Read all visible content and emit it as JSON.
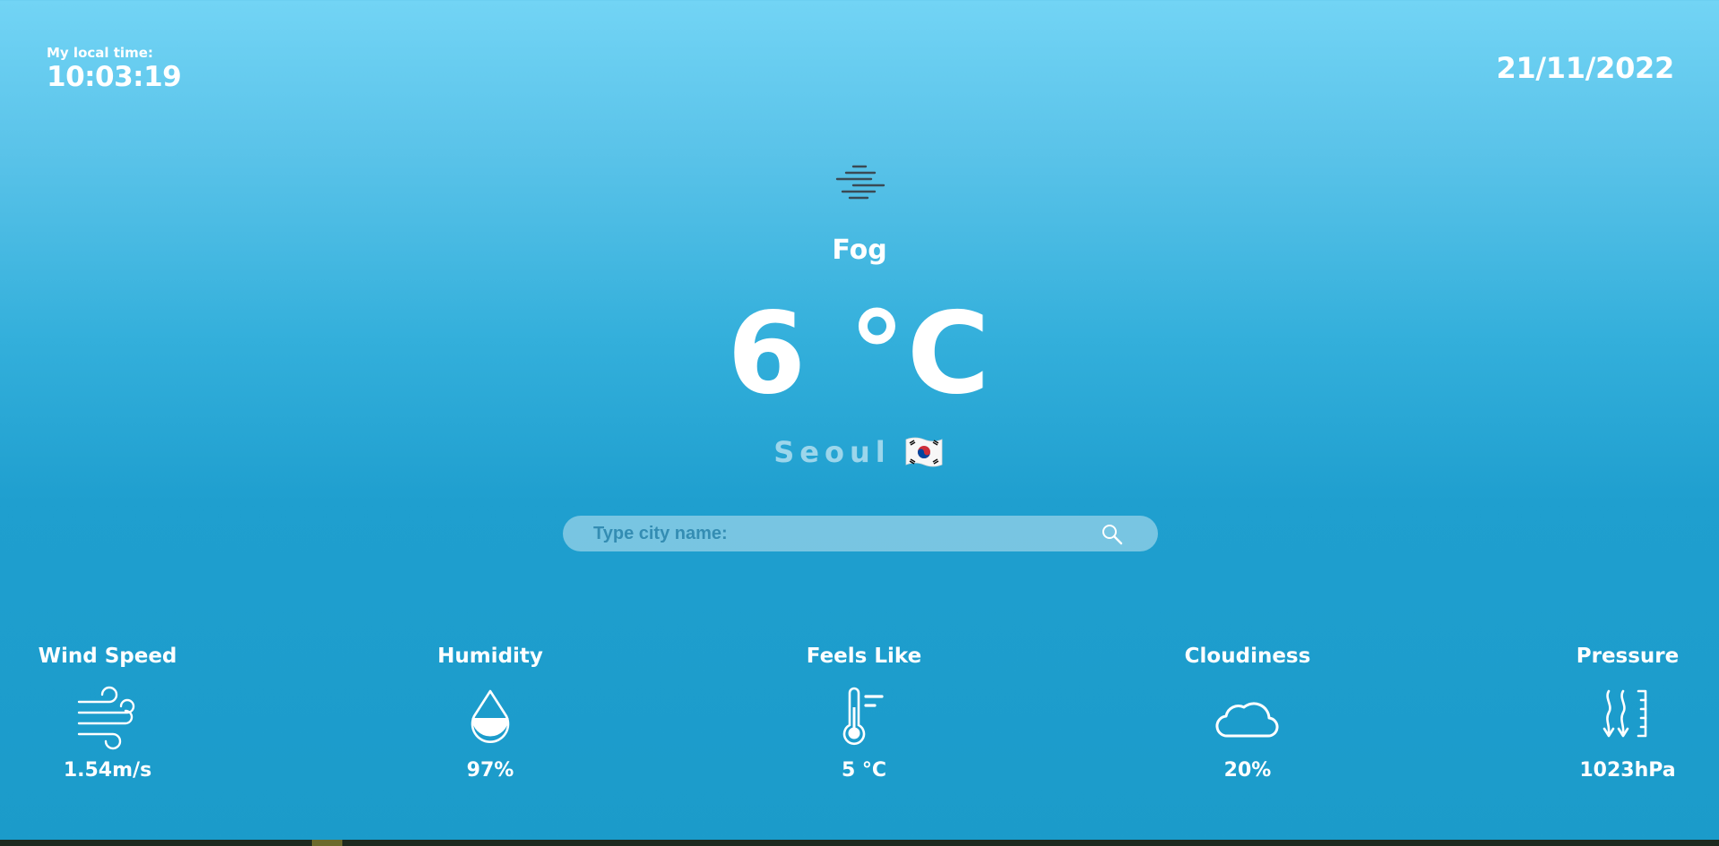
{
  "header": {
    "local_time_label": "My local time:",
    "local_time": "10:03:19",
    "date": "21/11/2022"
  },
  "current": {
    "icon": "fog-icon",
    "condition": "Fog",
    "temperature": "6 °C",
    "city": "Seoul",
    "flag": "south-korea-flag-icon"
  },
  "search": {
    "placeholder": "Type city name:",
    "value": ""
  },
  "stats": {
    "wind": {
      "title": "Wind Speed",
      "value": "1.54m/s",
      "icon": "wind-icon"
    },
    "humidity": {
      "title": "Humidity",
      "value": "97%",
      "icon": "water-drop-icon"
    },
    "feels_like": {
      "title": "Feels Like",
      "value": "5 °C",
      "icon": "thermometer-icon"
    },
    "cloudiness": {
      "title": "Cloudiness",
      "value": "20%",
      "icon": "cloud-icon"
    },
    "pressure": {
      "title": "Pressure",
      "value": "1023hPa",
      "icon": "pressure-gauge-icon"
    }
  },
  "colors": {
    "background_top": "#72d4f5",
    "background_bottom": "#1b9bca",
    "text": "#ffffff",
    "search_bar": "rgba(255,255,255,0.4)"
  }
}
